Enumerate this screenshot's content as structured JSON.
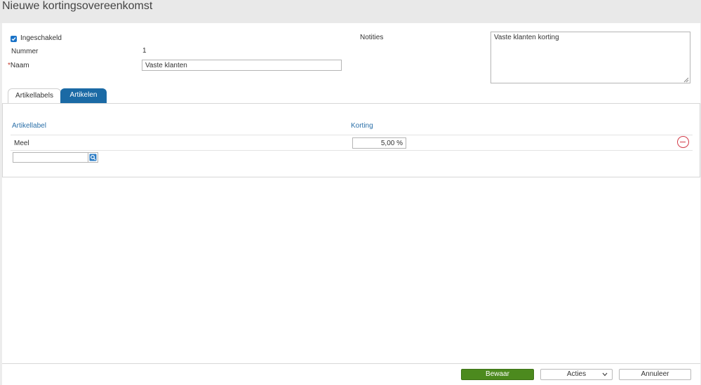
{
  "page": {
    "title": "Nieuwe kortingsovereenkomst"
  },
  "form": {
    "enabled_label": "Ingeschakeld",
    "enabled_checked": true,
    "number_label": "Nummer",
    "number_value": "1",
    "name_required_mark": "*",
    "name_label": "Naam",
    "name_value": "Vaste klanten",
    "notes_label": "Notities",
    "notes_value": "Vaste klanten korting"
  },
  "tabs": [
    {
      "label": "Artikellabels",
      "active": false
    },
    {
      "label": "Artikelen",
      "active": true
    }
  ],
  "grid": {
    "columns": [
      "Artikellabel",
      "Korting"
    ],
    "rows": [
      {
        "label": "Meel",
        "discount": "5,00 %"
      }
    ],
    "new_row_value": ""
  },
  "footer": {
    "save_label": "Bewaar",
    "actions_label": "Acties",
    "cancel_label": "Annuleer"
  },
  "colors": {
    "accent": "#1b6aa5",
    "save_button": "#4c8a1e",
    "remove_icon": "#d23a47",
    "column_header": "#2a6fa8"
  },
  "icons": {
    "enabled": "checkbox-checked-icon",
    "remove": "minus-circle-icon",
    "lookup": "search-lookup-icon",
    "actions": "chevron-down-icon",
    "resize": "resize-grip-icon"
  }
}
